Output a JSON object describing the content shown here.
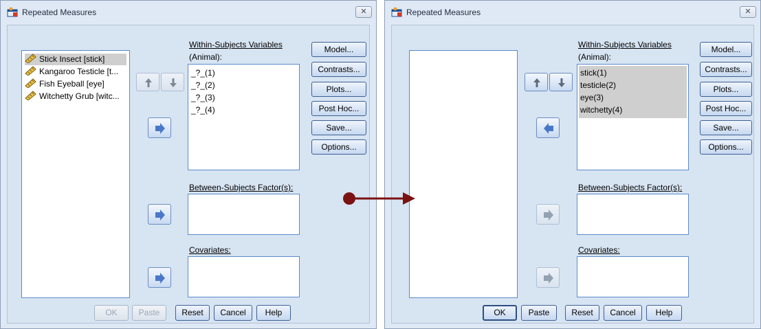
{
  "left_dialog": {
    "title": "Repeated Measures",
    "close_glyph": "✕",
    "source_list": [
      {
        "label": "Stick Insect [stick]",
        "selected": true
      },
      {
        "label": "Kangaroo Testicle [t...",
        "selected": false
      },
      {
        "label": "Fish Eyeball [eye]",
        "selected": false
      },
      {
        "label": "Witchetty Grub [witc...",
        "selected": false
      }
    ],
    "within_label_1": "Within-Subjects Variables",
    "within_label_2": "(Animal):",
    "within_items": [
      "_?_(1)",
      "_?_(2)",
      "_?_(3)",
      "_?_(4)"
    ],
    "between_label": "Between-Subjects Factor(s):",
    "covariates_label": "Covariates:",
    "side_buttons": [
      "Model...",
      "Contrasts...",
      "Plots...",
      "Post Hoc...",
      "Save...",
      "Options..."
    ],
    "bottom_buttons": {
      "ok": "OK",
      "paste": "Paste",
      "reset": "Reset",
      "cancel": "Cancel",
      "help": "Help"
    }
  },
  "right_dialog": {
    "title": "Repeated Measures",
    "close_glyph": "✕",
    "within_label_1": "Within-Subjects Variables",
    "within_label_2": "(Animal):",
    "within_items": [
      "stick(1)",
      "testicle(2)",
      "eye(3)",
      "witchetty(4)"
    ],
    "between_label": "Between-Subjects Factor(s):",
    "covariates_label": "Covariates:",
    "side_buttons": [
      "Model...",
      "Contrasts...",
      "Plots...",
      "Post Hoc...",
      "Save...",
      "Options..."
    ],
    "bottom_buttons": {
      "ok": "OK",
      "paste": "Paste",
      "reset": "Reset",
      "cancel": "Cancel",
      "help": "Help"
    }
  },
  "icons": {
    "window": "spss-repeated-measures-icon",
    "variable": "ruler-scale-icon",
    "arrows": [
      "arrow-up-icon",
      "arrow-down-icon",
      "arrow-right-icon",
      "arrow-left-icon"
    ]
  },
  "colors": {
    "dialog_bg": "#dfe9f5",
    "list_border": "#5b8ac9",
    "selected_bg": "#cfcfcf",
    "arrow_blue": "#4a78c8",
    "pointer": "#7b1212"
  }
}
